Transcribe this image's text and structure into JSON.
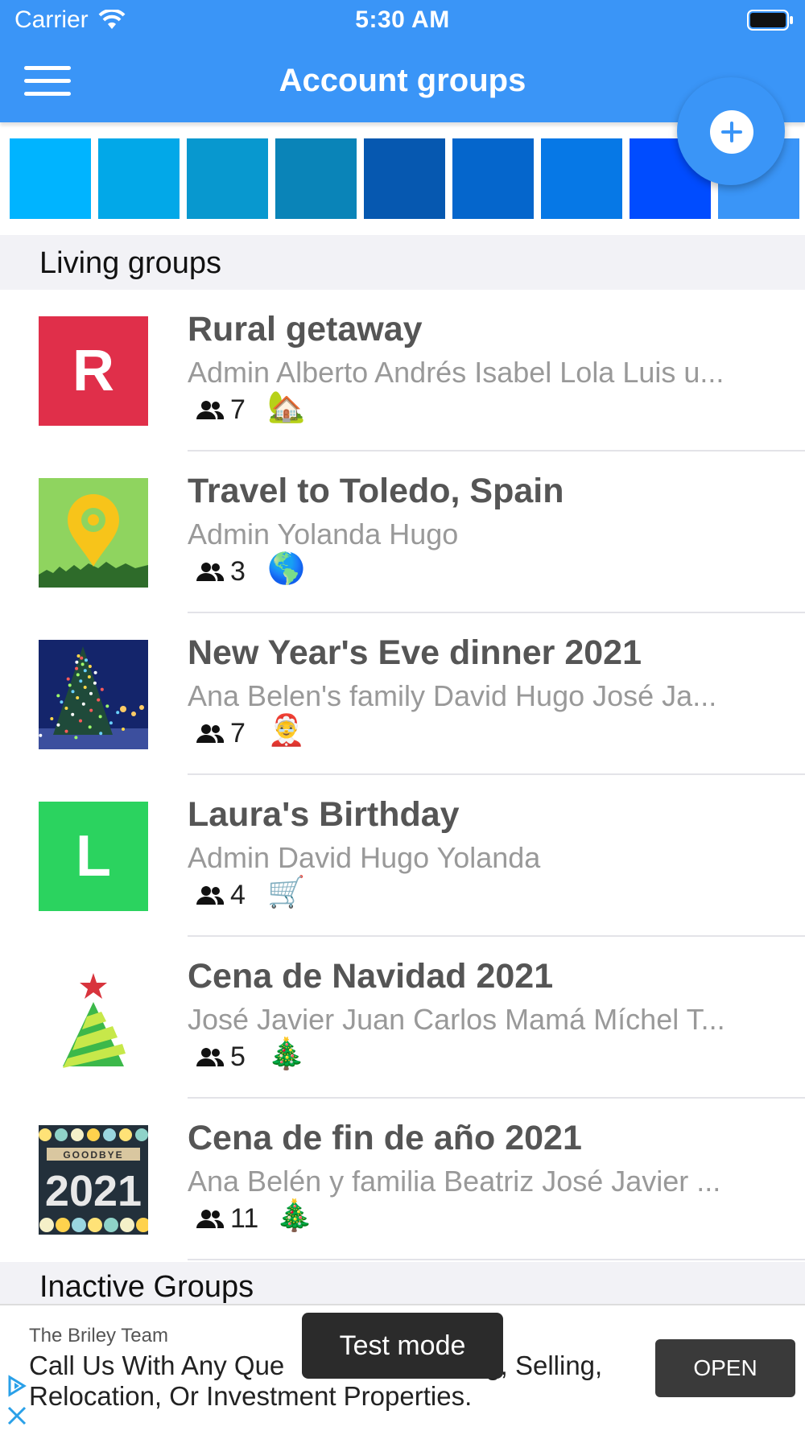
{
  "status_bar": {
    "carrier": "Carrier",
    "time": "5:30 AM",
    "wifi_icon": "wifi-icon",
    "battery_icon": "battery-icon"
  },
  "nav": {
    "title": "Account groups",
    "menu_icon": "hamburger-menu-icon",
    "add_icon": "plus-icon",
    "accent_color": "#3a95f7"
  },
  "color_swatches": [
    "#00b4ff",
    "#02a8e8",
    "#0898cf",
    "#0a84b8",
    "#0658b0",
    "#0566cc",
    "#0678e6",
    "#004cff",
    "#3a95f7"
  ],
  "sections": {
    "living": "Living groups",
    "inactive": "Inactive Groups"
  },
  "groups": [
    {
      "title": "Rural getaway",
      "members": "Admin Alberto Andrés Isabel Lola Luis u...",
      "count": "7",
      "emoji": "🏡",
      "thumb": "letter",
      "letter": "R",
      "thumb_color": "#e02f4a"
    },
    {
      "title": "Travel to Toledo, Spain",
      "members": "Admin Yolanda Hugo",
      "count": "3",
      "emoji": "🌎",
      "thumb": "map-pin-image"
    },
    {
      "title": "New Year's Eve dinner 2021",
      "members": "Ana Belen's family David Hugo José Ja...",
      "count": "7",
      "emoji": "🤶",
      "thumb": "christmas-tree-night-image"
    },
    {
      "title": "Laura's Birthday",
      "members": "Admin David Hugo Yolanda",
      "count": "4",
      "emoji": "🛒",
      "thumb": "letter",
      "letter": "L",
      "thumb_color": "#2bd35f"
    },
    {
      "title": "Cena de Navidad 2021",
      "members": "José Javier Juan Carlos Mamá Míchel T...",
      "count": "5",
      "emoji": "🎄",
      "thumb": "christmas-tree-drawing"
    },
    {
      "title": "Cena de fin de año 2021",
      "members": "Ana Belén y familia Beatriz José Javier ...",
      "count": "11",
      "emoji": "🎄",
      "thumb": "goodbye-2021-image",
      "thumb_text_top": "GOODBYE",
      "thumb_text_year": "2021"
    }
  ],
  "ad": {
    "advertiser": "The Briley Team",
    "line1": "Call Us With Any Que",
    "line1_end": "g, Selling,",
    "line2": "Relocation, Or Investment Properties.",
    "open_label": "OPEN",
    "toast": "Test mode"
  }
}
